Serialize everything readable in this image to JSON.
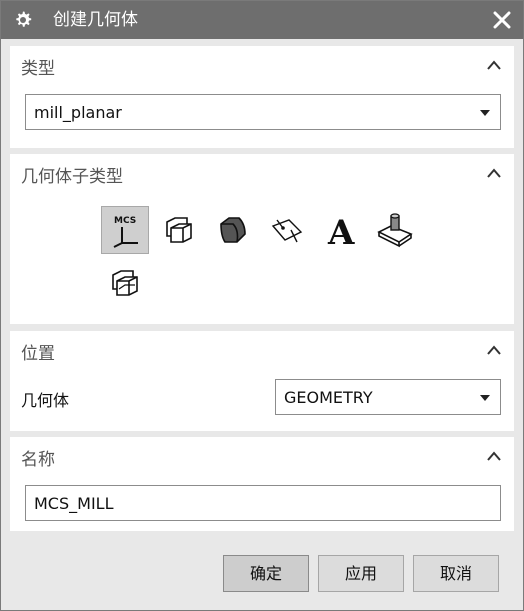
{
  "window": {
    "title": "创建几何体"
  },
  "sections": {
    "type": {
      "title": "类型",
      "selected": "mill_planar"
    },
    "subtype": {
      "title": "几何体子类型",
      "icons": [
        {
          "name": "mcs-icon",
          "label": "MCS",
          "selected": true
        },
        {
          "name": "workpiece-icon",
          "selected": false
        },
        {
          "name": "mill-boundary-icon",
          "selected": false
        },
        {
          "name": "mill-area-icon",
          "selected": false
        },
        {
          "name": "mill-text-icon",
          "label": "A",
          "selected": false
        },
        {
          "name": "mill-geom-icon",
          "selected": false
        },
        {
          "name": "mill-bnd-icon",
          "selected": false
        }
      ]
    },
    "location": {
      "title": "位置",
      "geometry_label": "几何体",
      "geometry_value": "GEOMETRY"
    },
    "name": {
      "title": "名称",
      "value": "MCS_MILL"
    }
  },
  "buttons": {
    "ok": "确定",
    "apply": "应用",
    "cancel": "取消"
  }
}
